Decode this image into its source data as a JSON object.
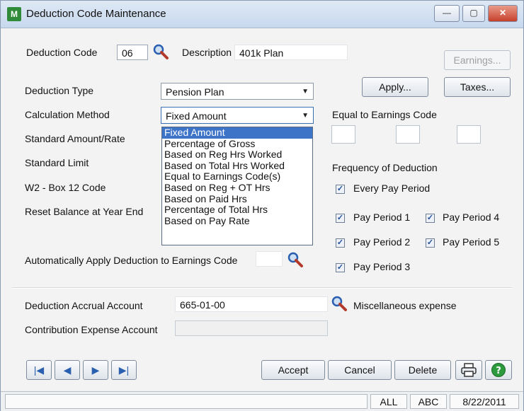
{
  "window": {
    "title": "Deduction Code Maintenance",
    "app_icon_text": "M",
    "controls": {
      "minimize": "—",
      "maximize": "▢",
      "close": "✕"
    }
  },
  "header": {
    "deduction_code_label": "Deduction Code",
    "deduction_code_value": "06",
    "description_label": "Description",
    "description_value": "401k Plan"
  },
  "buttons": {
    "earnings": "Earnings...",
    "apply": "Apply...",
    "taxes": "Taxes...",
    "accept": "Accept",
    "cancel": "Cancel",
    "delete": "Delete"
  },
  "form": {
    "deduction_type_label": "Deduction Type",
    "deduction_type_value": "Pension Plan",
    "calculation_method_label": "Calculation Method",
    "calculation_method_value": "Fixed Amount",
    "standard_amount_label": "Standard Amount/Rate",
    "standard_limit_label": "Standard Limit",
    "w2_box12_label": "W2 - Box 12 Code",
    "reset_balance_label": "Reset Balance at Year End",
    "auto_apply_label": "Automatically Apply Deduction to Earnings Code",
    "accrual_account_label": "Deduction Accrual Account",
    "accrual_account_value": "665-01-00",
    "accrual_account_desc": "Miscellaneous expense",
    "contribution_account_label": "Contribution Expense Account"
  },
  "calc_dropdown": {
    "options": [
      "Fixed Amount",
      "Percentage of Gross",
      "Based on Reg Hrs Worked",
      "Based on Total Hrs Worked",
      "Equal to Earnings Code(s)",
      "Based on Reg + OT Hrs",
      "Based on Paid Hrs",
      "Percentage of Total Hrs",
      "Based on Pay Rate"
    ],
    "selected_index": 0
  },
  "right_panel": {
    "equal_to_label": "Equal to Earnings Code",
    "frequency_label": "Frequency of Deduction",
    "every_pay_period": "Every Pay Period",
    "pay_period_1": "Pay Period 1",
    "pay_period_2": "Pay Period 2",
    "pay_period_3": "Pay Period 3",
    "pay_period_4": "Pay Period 4",
    "pay_period_5": "Pay Period 5"
  },
  "status": {
    "cell1": "ALL",
    "cell2": "ABC",
    "date": "8/22/2011"
  },
  "colors": {
    "selection": "#3d74c8",
    "checkmark": "#1f4e9a",
    "help_icon": "#2e9a3e"
  }
}
